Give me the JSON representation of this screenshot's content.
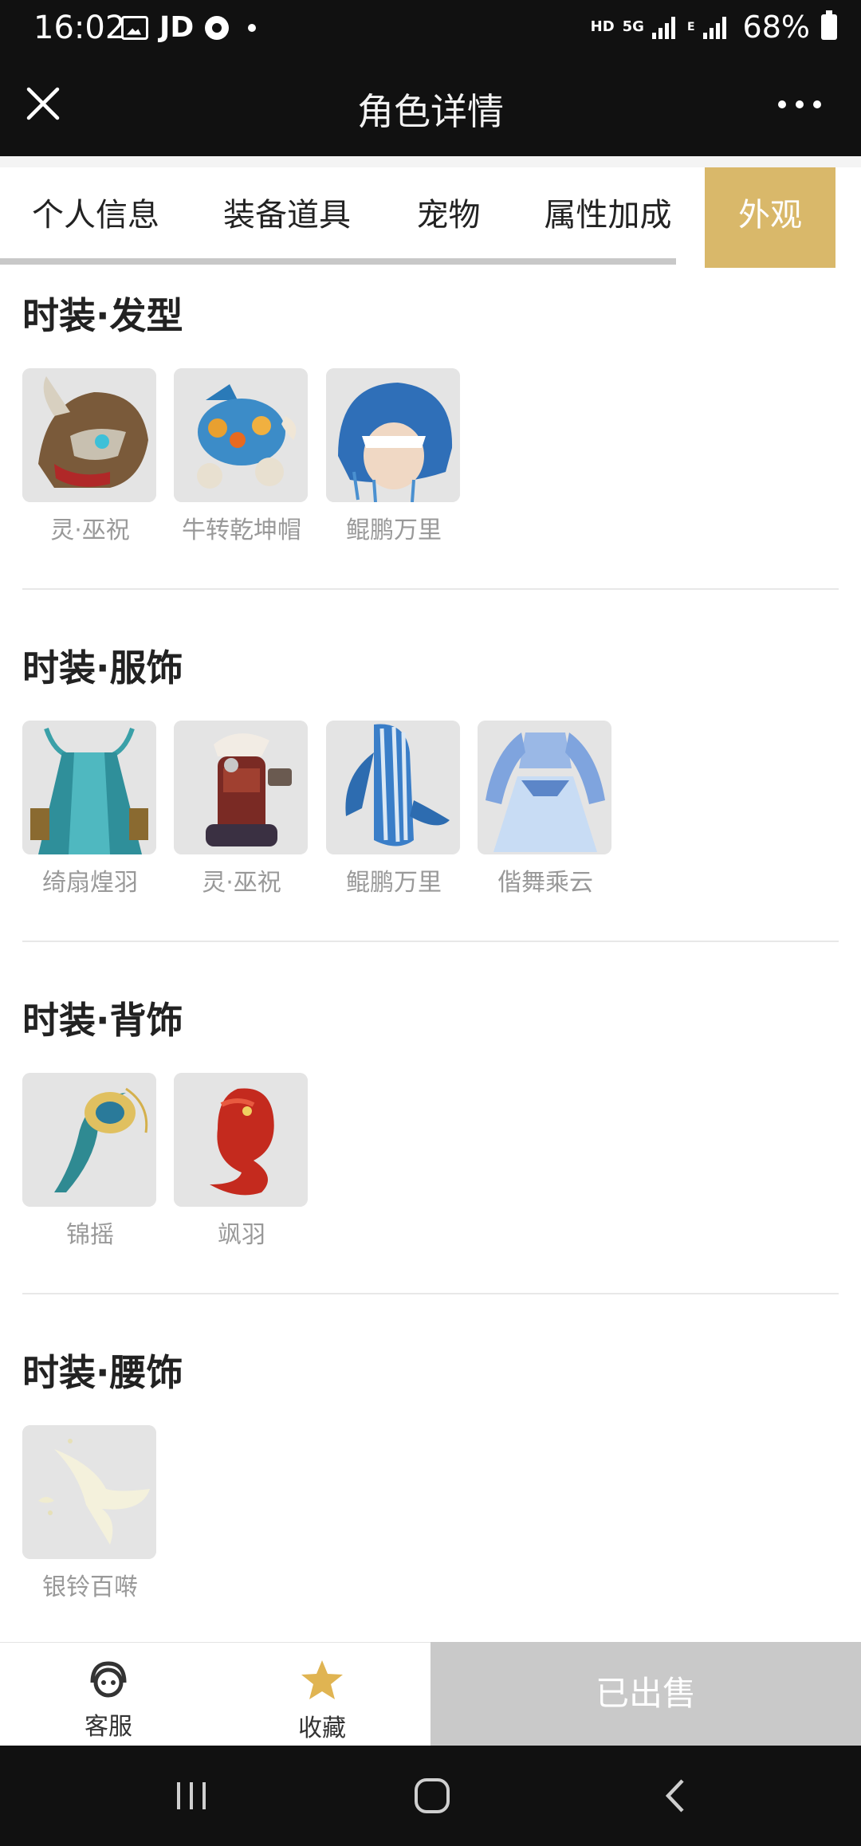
{
  "status_bar": {
    "time": "16:02",
    "carrier": "JD",
    "network_hd": "HD",
    "network_5g": "5G",
    "network_e": "E",
    "battery": "68%"
  },
  "header": {
    "title": "角色详情"
  },
  "tabs": [
    {
      "label": "个人信息",
      "active": false
    },
    {
      "label": "装备道具",
      "active": false
    },
    {
      "label": "宠物",
      "active": false
    },
    {
      "label": "属性加成",
      "active": false
    },
    {
      "label": "外观",
      "active": true
    }
  ],
  "sections": [
    {
      "title": "时装·发型",
      "items": [
        {
          "name": "灵·巫祝"
        },
        {
          "name": "牛转乾坤帽"
        },
        {
          "name": "鲲鹏万里"
        }
      ]
    },
    {
      "title": "时装·服饰",
      "items": [
        {
          "name": "绮扇煌羽"
        },
        {
          "name": "灵·巫祝"
        },
        {
          "name": "鲲鹏万里"
        },
        {
          "name": "偕舞乘云"
        }
      ]
    },
    {
      "title": "时装·背饰",
      "items": [
        {
          "name": "锦摇"
        },
        {
          "name": "飒羽"
        }
      ]
    },
    {
      "title": "时装·腰饰",
      "items": [
        {
          "name": "银铃百啭"
        }
      ]
    }
  ],
  "bottom_bar": {
    "service_label": "客服",
    "favorite_label": "收藏",
    "status_button": "已出售"
  },
  "colors": {
    "accent": "#d9b86a",
    "header_bg": "#111111",
    "sold_bg": "#c9c9c9"
  }
}
